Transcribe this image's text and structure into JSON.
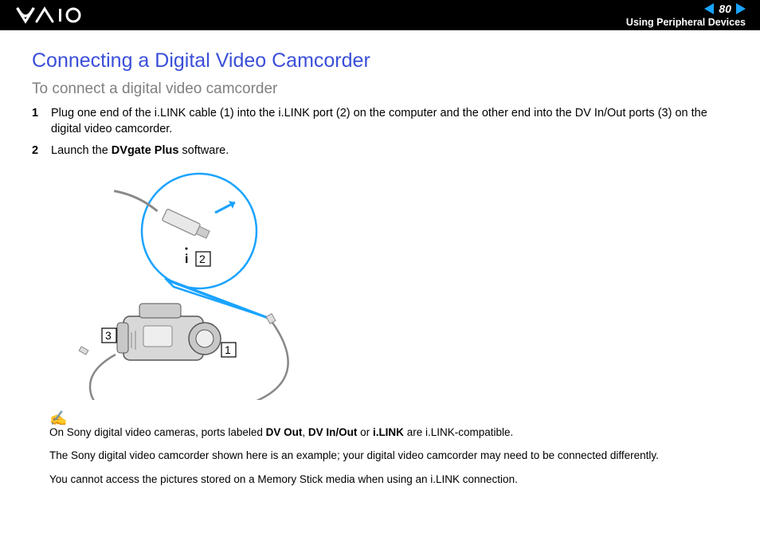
{
  "header": {
    "page_number": "80",
    "breadcrumb": "Using Peripheral Devices"
  },
  "title": "Connecting a Digital Video Camcorder",
  "subtitle": "To connect a digital video camcorder",
  "steps": [
    {
      "num": "1",
      "text_before": "Plug one end of the i.LINK cable (1) into the i.LINK port (2) on the computer and the other end into the DV In/Out ports (3) on the digital video camcorder."
    },
    {
      "num": "2",
      "text_before": "Launch the ",
      "bold": "DVgate Plus",
      "text_after": " software."
    }
  ],
  "diagram_labels": {
    "l1": "1",
    "l2": "2",
    "l3": "3"
  },
  "notes": {
    "line1_a": "On Sony digital video cameras, ports labeled ",
    "line1_b1": "DV Out",
    "line1_c": ", ",
    "line1_b2": "DV In/Out",
    "line1_d": " or ",
    "line1_b3": "i.LINK",
    "line1_e": " are i.LINK-compatible.",
    "line2": "The Sony digital video camcorder shown here is an example; your digital video camcorder may need to be connected differently.",
    "line3": "You cannot access the pictures stored on a Memory Stick media when using an i.LINK connection."
  }
}
